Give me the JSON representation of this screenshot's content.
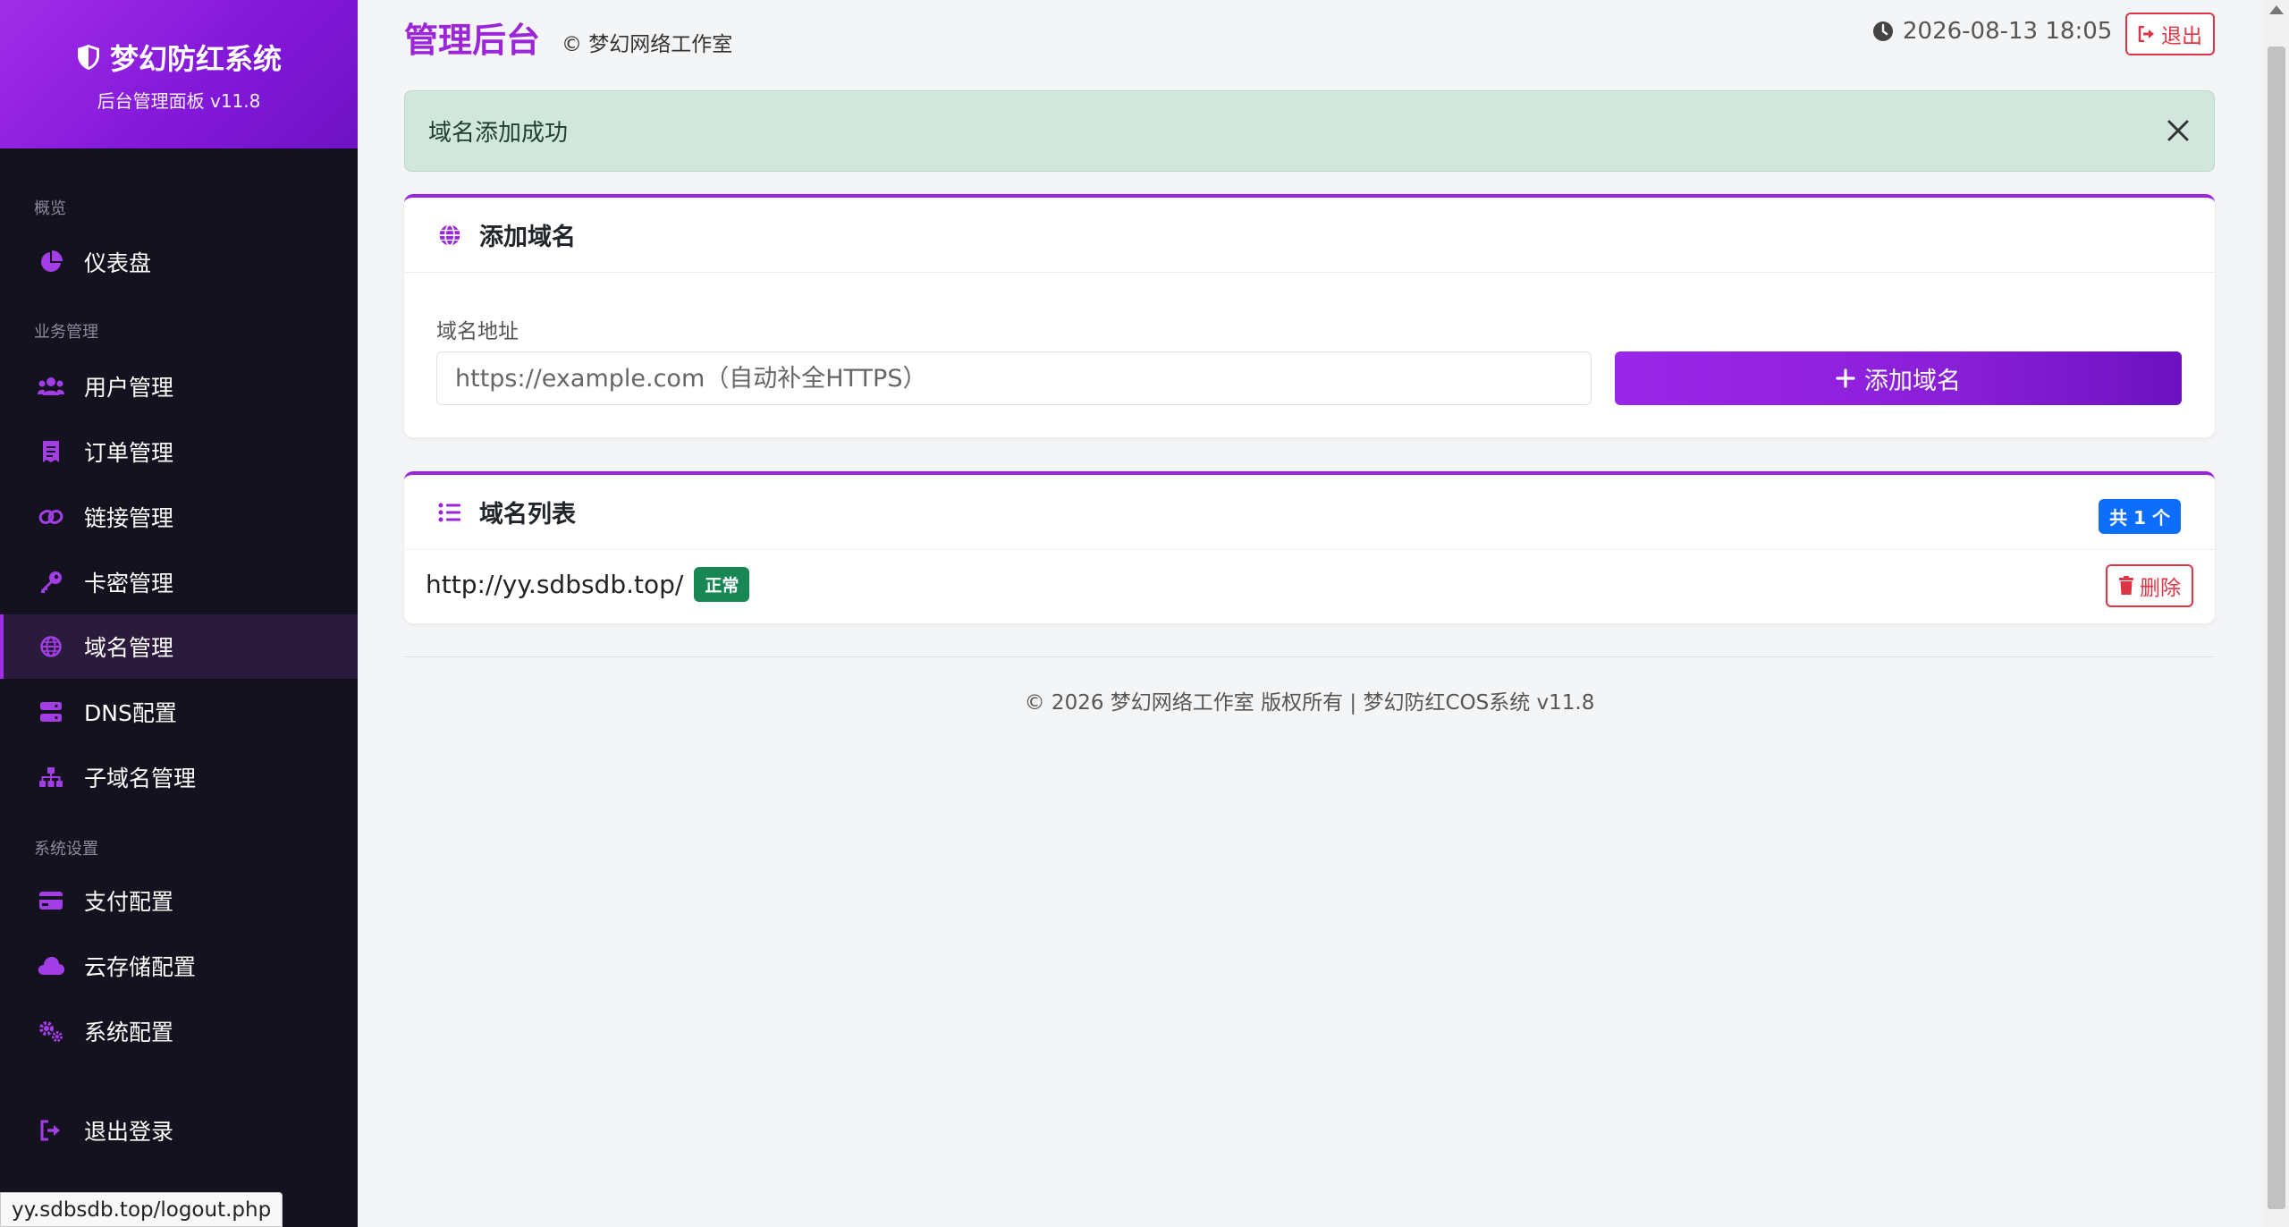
{
  "brand": {
    "title": "梦幻防红系统",
    "subtitle": "后台管理面板 v11.8"
  },
  "sidebar": {
    "sections": [
      {
        "label": "概览"
      },
      {
        "label": "业务管理"
      },
      {
        "label": "系统设置"
      }
    ],
    "items": [
      {
        "label": "仪表盘",
        "icon": "chart-pie-icon"
      },
      {
        "label": "用户管理",
        "icon": "users-icon"
      },
      {
        "label": "订单管理",
        "icon": "receipt-icon"
      },
      {
        "label": "链接管理",
        "icon": "link-icon"
      },
      {
        "label": "卡密管理",
        "icon": "key-icon"
      },
      {
        "label": "域名管理",
        "icon": "globe-icon",
        "active": true
      },
      {
        "label": "DNS配置",
        "icon": "server-icon"
      },
      {
        "label": "子域名管理",
        "icon": "sitemap-icon"
      },
      {
        "label": "支付配置",
        "icon": "credit-card-icon"
      },
      {
        "label": "云存储配置",
        "icon": "cloud-icon"
      },
      {
        "label": "系统配置",
        "icon": "cogs-icon"
      },
      {
        "label": "退出登录",
        "icon": "sign-out-icon"
      }
    ]
  },
  "header": {
    "title": "管理后台",
    "subtitle": "© 梦幻网络工作室",
    "datetime": "2026-08-13 18:05",
    "logout_label": "退出"
  },
  "alert": {
    "message": "域名添加成功"
  },
  "add_domain": {
    "title": "添加域名",
    "field_label": "域名地址",
    "placeholder": "https://example.com（自动补全HTTPS）",
    "button_label": "添加域名"
  },
  "domain_list": {
    "title": "域名列表",
    "count_badge": "共 1 个",
    "rows": [
      {
        "url": "http://yy.sdbsdb.top/",
        "status": "正常",
        "delete_label": "删除"
      }
    ]
  },
  "footer": {
    "text": "© 2026 梦幻网络工作室 版权所有 | 梦幻防红COS系统 v11.8"
  },
  "status_bar": {
    "url": "yy.sdbsdb.top/logout.php"
  },
  "colors": {
    "accent": "#9b26d9",
    "sidebar_bg": "#14121e",
    "success": "#198754",
    "danger": "#dc3545",
    "primary_badge": "#0d6efd",
    "alert_bg": "#d1e7dd"
  }
}
